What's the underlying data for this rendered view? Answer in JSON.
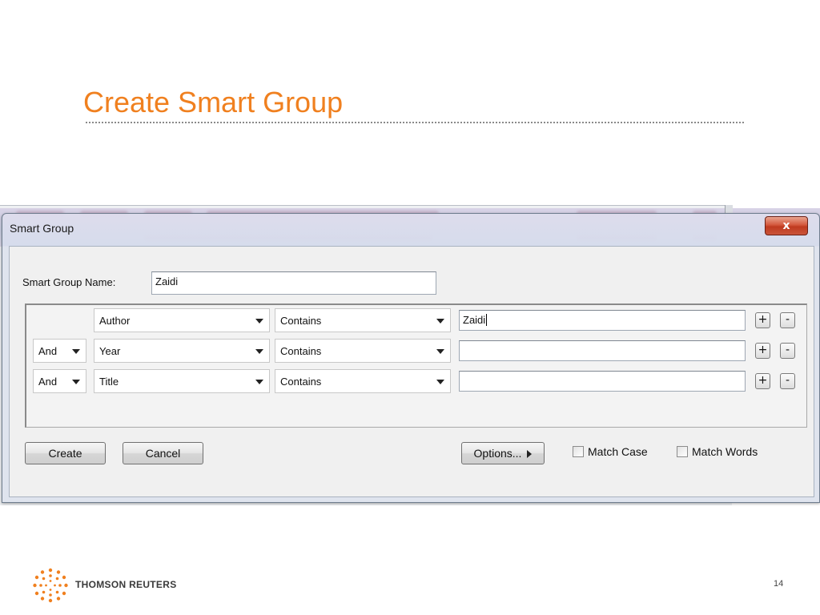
{
  "slide": {
    "title": "Create Smart Group",
    "page_number": "14",
    "brand": "THOMSON REUTERS",
    "accent_color": "#f0801f"
  },
  "dialog": {
    "title": "Smart Group",
    "close_label": "x",
    "name_label": "Smart Group Name:",
    "name_value": "Zaidi",
    "criteria": [
      {
        "connector": "",
        "field": "Author",
        "operator": "Contains",
        "value": "Zaidi"
      },
      {
        "connector": "And",
        "field": "Year",
        "operator": "Contains",
        "value": ""
      },
      {
        "connector": "And",
        "field": "Title",
        "operator": "Contains",
        "value": ""
      }
    ],
    "add_label": "+",
    "remove_label": "-",
    "create_label": "Create",
    "cancel_label": "Cancel",
    "options_label": "Options...",
    "match_case_label": "Match Case",
    "match_case_checked": false,
    "match_words_label": "Match Words",
    "match_words_checked": false
  },
  "icons": {
    "close": "close-icon",
    "dropdown": "chevron-down-icon",
    "options": "triangle-right-icon",
    "logo": "thomson-reuters-dot-sphere-icon"
  }
}
